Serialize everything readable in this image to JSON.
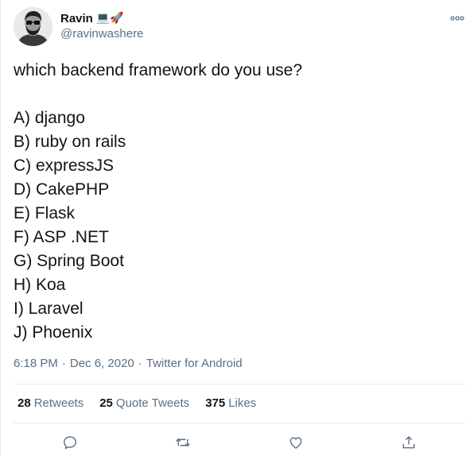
{
  "author": {
    "display_name": "Ravin",
    "emoji": "💻🚀",
    "handle": "@ravinwashere"
  },
  "tweet": {
    "lines": [
      "which backend framework do you use?",
      "",
      "A) django",
      "B) ruby on rails",
      "C) expressJS",
      "D) CakePHP",
      "E) Flask",
      "F) ASP .NET",
      "G) Spring Boot",
      "H) Koa",
      "I) Laravel",
      "J) Phoenix"
    ]
  },
  "meta": {
    "time": "6:18 PM",
    "date": "Dec 6, 2020",
    "separator": "·",
    "source": "Twitter for Android"
  },
  "stats": {
    "retweets": {
      "count": "28",
      "label": "Retweets"
    },
    "quote_tweets": {
      "count": "25",
      "label": "Quote Tweets"
    },
    "likes": {
      "count": "375",
      "label": "Likes"
    }
  },
  "icons": {
    "more": "more-icon",
    "reply": "reply-icon",
    "retweet": "retweet-icon",
    "like": "like-icon",
    "share": "share-icon"
  },
  "colors": {
    "text": "#0f1419",
    "secondary": "#5b7083",
    "divider": "#e6ecf0"
  }
}
